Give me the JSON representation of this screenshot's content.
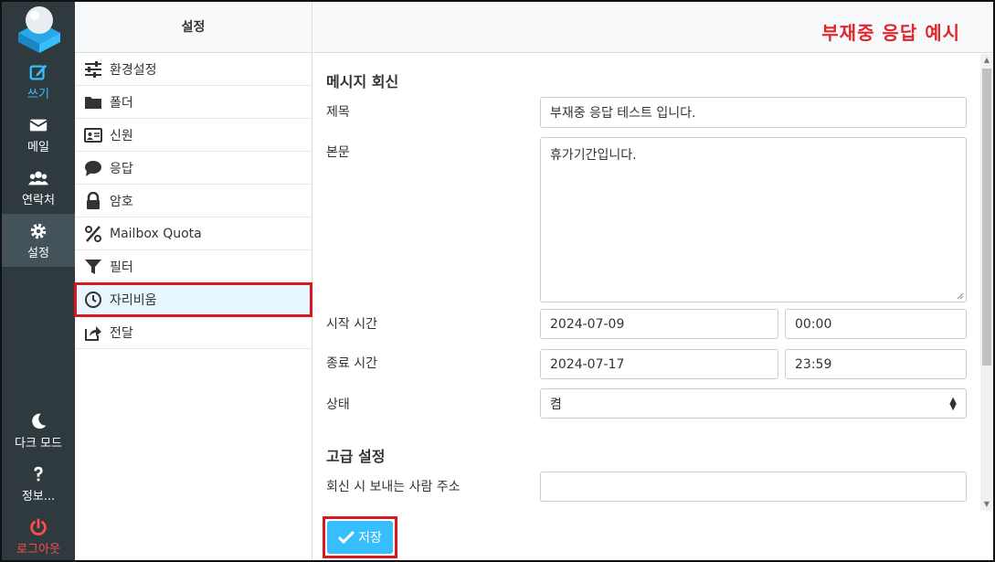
{
  "colors": {
    "accent": "#37beff",
    "nav_bg": "#2f3a3f",
    "danger": "#ff4c4c",
    "highlight": "#d9181f",
    "headline": "#e0262c"
  },
  "nav": {
    "compose": "쓰기",
    "mail": "메일",
    "contacts": "연락처",
    "settings": "설정",
    "dark_mode": "다크 모드",
    "about": "정보...",
    "logout": "로그아웃"
  },
  "settings_list": {
    "title": "설정",
    "items": [
      {
        "label": "환경설정",
        "icon": "sliders-icon"
      },
      {
        "label": "폴더",
        "icon": "folder-icon"
      },
      {
        "label": "신원",
        "icon": "id-card-icon"
      },
      {
        "label": "응답",
        "icon": "comment-icon"
      },
      {
        "label": "암호",
        "icon": "lock-icon"
      },
      {
        "label": "Mailbox Quota",
        "icon": "percent-icon"
      },
      {
        "label": "필터",
        "icon": "filter-icon"
      },
      {
        "label": "자리비움",
        "icon": "clock-icon"
      },
      {
        "label": "전달",
        "icon": "share-icon"
      }
    ]
  },
  "header": {
    "annotation": "부재중 응답 예시"
  },
  "form": {
    "section_reply": "메시지 회신",
    "subject_label": "제목",
    "subject_value": "부재중 응답 테스트 입니다.",
    "body_label": "본문",
    "body_value": "휴가기간입니다.",
    "start_label": "시작 시간",
    "start_date": "2024-07-09",
    "start_time": "00:00",
    "end_label": "종료 시간",
    "end_date": "2024-07-17",
    "end_time": "23:59",
    "status_label": "상태",
    "status_value": "켬",
    "section_advanced": "고급 설정",
    "reply_from_label": "회신 시 보내는 사람 주소",
    "reply_from_value": ""
  },
  "footer": {
    "save_label": "저장"
  }
}
